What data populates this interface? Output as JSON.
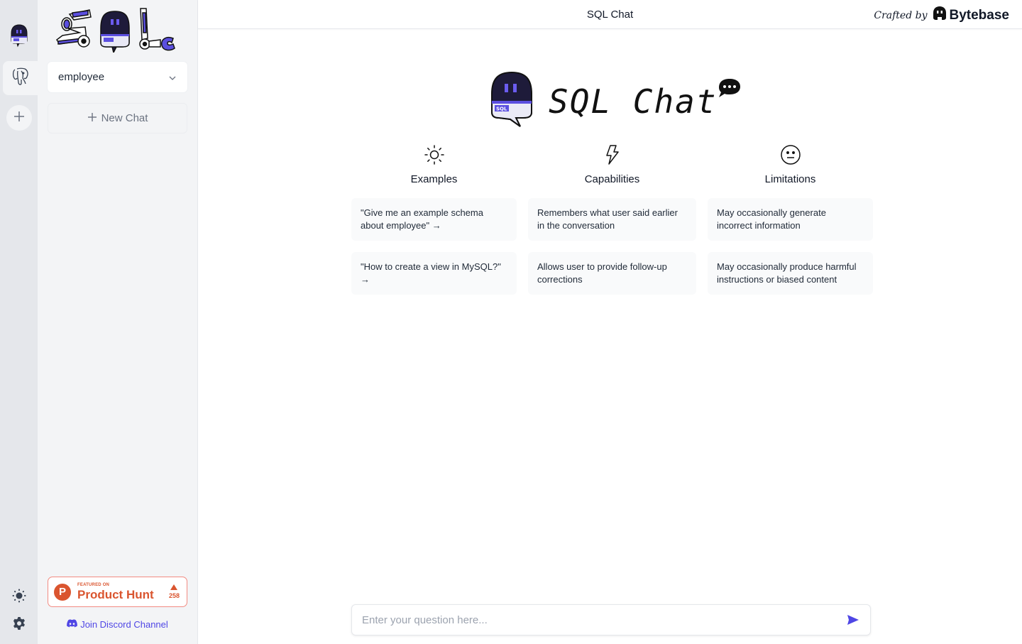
{
  "app": {
    "title": "SQL Chat",
    "crafted_by": "Crafted by",
    "brand": "Bytebase"
  },
  "rail": {
    "items": [
      {
        "name": "sql-chat-bot",
        "icon": "robot-icon"
      },
      {
        "name": "postgresql-connection",
        "icon": "postgresql-elephant-icon",
        "active": true
      }
    ],
    "add_icon": "plus-icon",
    "theme_icon": "sun-icon",
    "settings_icon": "gear-icon"
  },
  "sidebar": {
    "database_select": {
      "value": "employee"
    },
    "new_chat_label": "New Chat",
    "product_hunt": {
      "featured": "FEATURED ON",
      "name": "Product Hunt",
      "votes": "258"
    },
    "discord_label": "Join Discord Channel"
  },
  "hero": {
    "title": "SQL Chat"
  },
  "columns": [
    {
      "icon": "sun-icon",
      "title": "Examples",
      "cards": [
        "\"Give me an example schema about employee\" →",
        "\"How to create a view in MySQL?\" →"
      ]
    },
    {
      "icon": "lightning-icon",
      "title": "Capabilities",
      "cards": [
        "Remembers what user said earlier in the conversation",
        "Allows user to provide follow-up corrections"
      ]
    },
    {
      "icon": "neutral-face-icon",
      "title": "Limitations",
      "cards": [
        "May occasionally generate incorrect information",
        "May occasionally produce harmful instructions or biased content"
      ]
    }
  ],
  "input": {
    "placeholder": "Enter your question here...",
    "value": ""
  },
  "colors": {
    "accent": "#4f46e5",
    "product_hunt": "#da552f",
    "rail_bg": "#e5e7eb",
    "sidebar_bg": "#f3f4f6"
  }
}
